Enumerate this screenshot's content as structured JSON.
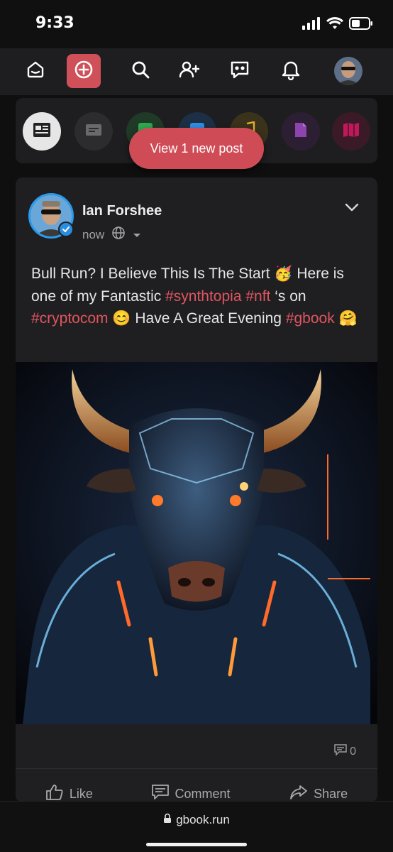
{
  "status_bar": {
    "time": "9:33",
    "icons": [
      "signal-icon",
      "wifi-icon",
      "battery-icon"
    ]
  },
  "topnav": {
    "items": [
      {
        "name": "home-icon"
      },
      {
        "name": "create-post-icon"
      },
      {
        "name": "search-icon"
      },
      {
        "name": "add-friend-icon"
      },
      {
        "name": "messages-icon"
      },
      {
        "name": "notifications-icon"
      },
      {
        "name": "profile-avatar"
      }
    ],
    "accent": "#d0505a"
  },
  "shortcuts": [
    {
      "name": "news-feed-icon",
      "color": "#e6e6e6"
    },
    {
      "name": "pages-icon",
      "color": "#3a3a3c"
    },
    {
      "name": "groups-icon",
      "color": "#2fa84f"
    },
    {
      "name": "blogs-icon",
      "color": "#2f8de4"
    },
    {
      "name": "music-icon",
      "color": "#e1b12c"
    },
    {
      "name": "documents-icon",
      "color": "#8e44ad"
    },
    {
      "name": "marketplace-icon",
      "color": "#c2185b"
    }
  ],
  "new_post_banner": "View 1 new post",
  "post": {
    "author": "Ian Forshee",
    "time": "now",
    "text_parts": [
      {
        "text": "Bull Run? I Believe This Is The Start 🥳 Here is one of my Fantastic ",
        "tag": false
      },
      {
        "text": "#synthtopia",
        "tag": true
      },
      {
        "text": " ",
        "tag": false
      },
      {
        "text": "#nft",
        "tag": true
      },
      {
        "text": " ‘s on ",
        "tag": false
      },
      {
        "text": "#cryptocom",
        "tag": true
      },
      {
        "text": " 😊 Have A Great Evening ",
        "tag": false
      },
      {
        "text": "#gbook",
        "tag": true
      },
      {
        "text": " 🤗",
        "tag": false
      }
    ],
    "comment_count": "0",
    "actions": {
      "like": "Like",
      "comment": "Comment",
      "share": "Share"
    }
  },
  "url_bar": {
    "url": "gbook.run"
  },
  "colors": {
    "background": "#0f0f10",
    "card": "#1f1f21",
    "hashtag": "#e05560",
    "verified": "#2a8ee0"
  }
}
